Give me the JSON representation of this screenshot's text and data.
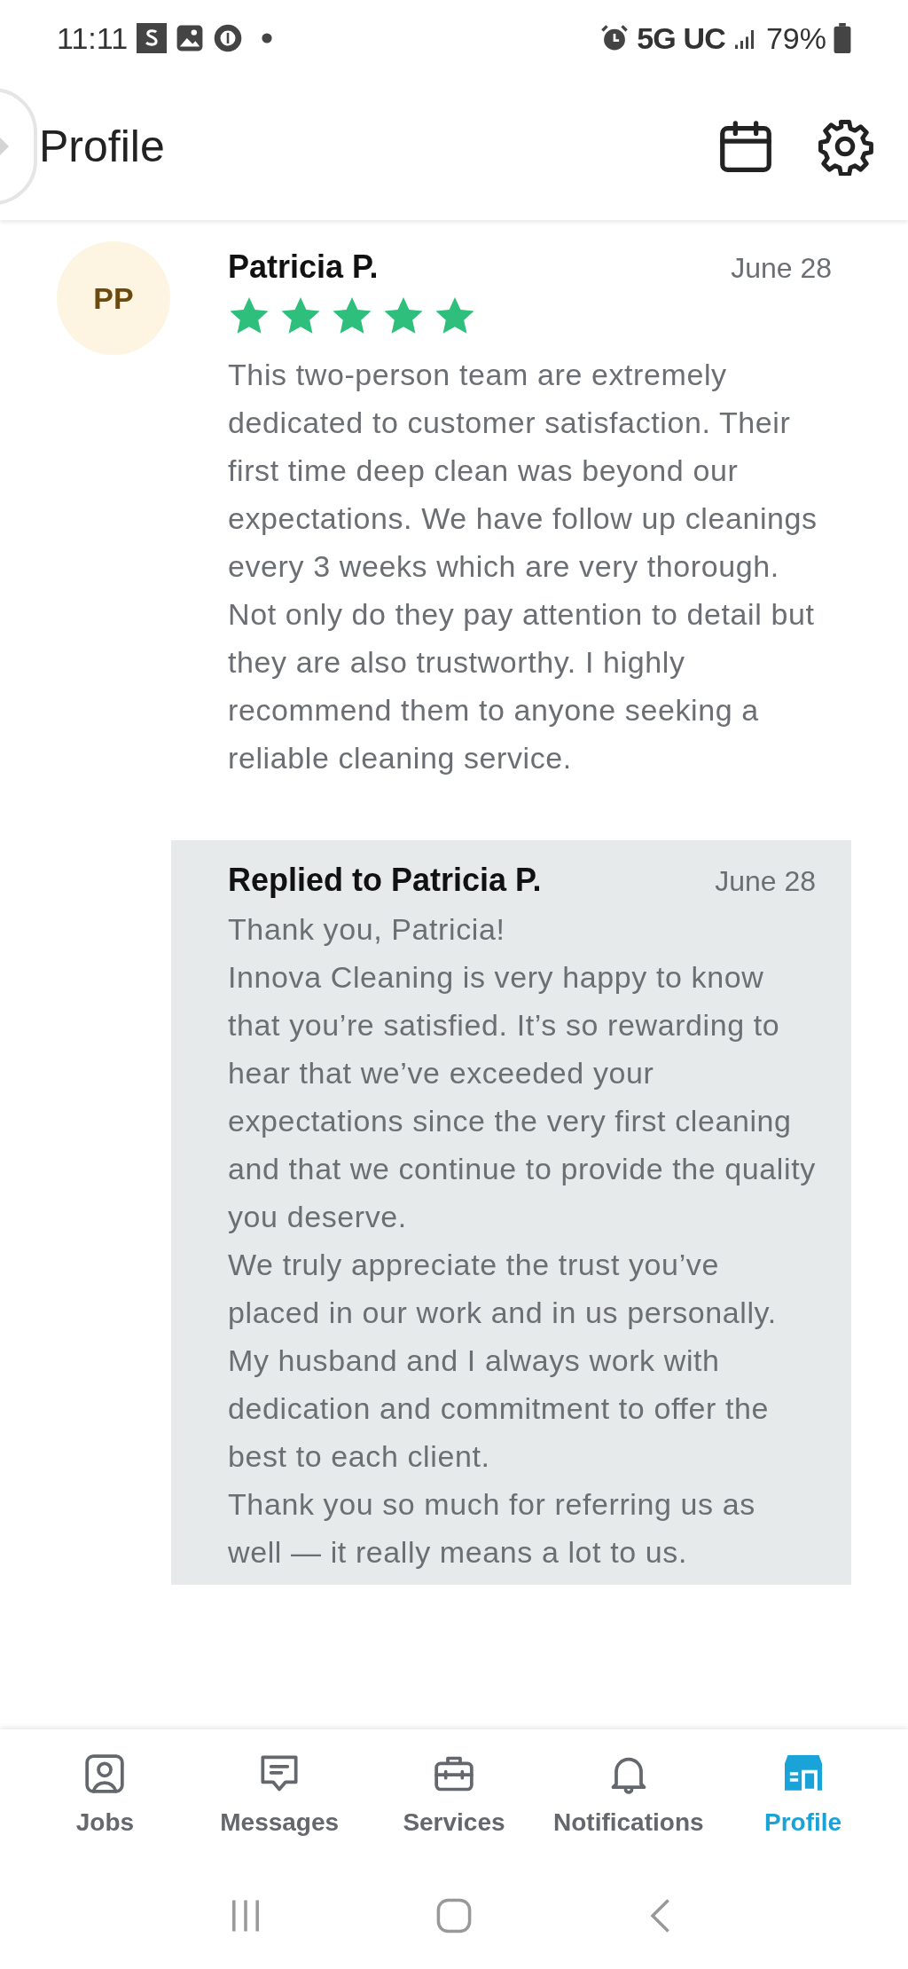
{
  "status_bar": {
    "time": "11:11",
    "network": "5G UC",
    "battery": "79%"
  },
  "header": {
    "title": "Profile"
  },
  "review": {
    "initials": "PP",
    "name": "Patricia P.",
    "date": "June 28",
    "stars": 5,
    "text": "This two-person team are extremely dedicated to customer satisfaction. Their first time deep clean was beyond our expectations. We have follow up cleanings every 3 weeks which are very thorough. Not only do they pay attention to detail but they are also trustworthy. I highly recommend them to anyone seeking a reliable cleaning service."
  },
  "reply": {
    "title": "Replied to Patricia P.",
    "date": "June 28",
    "paragraphs": [
      "Thank you, Patricia!",
      "Innova Cleaning is very happy to know that you’re satisfied. It’s so rewarding to hear that we’ve exceeded your expectations since the very first cleaning and that we continue to provide the quality you deserve.",
      "We truly appreciate the trust you’ve placed in our work and in us personally. My husband and I always work with dedication and commitment to offer the best to each client.",
      "Thank you so much for referring us as well — it really means a lot to us."
    ]
  },
  "nav": [
    {
      "kind": "jobs",
      "label": "Jobs",
      "selected": false
    },
    {
      "kind": "messages",
      "label": "Messages",
      "selected": false
    },
    {
      "kind": "services",
      "label": "Services",
      "selected": false
    },
    {
      "kind": "notifications",
      "label": "Notifications",
      "selected": false
    },
    {
      "kind": "profile",
      "label": "Profile",
      "selected": true
    }
  ]
}
